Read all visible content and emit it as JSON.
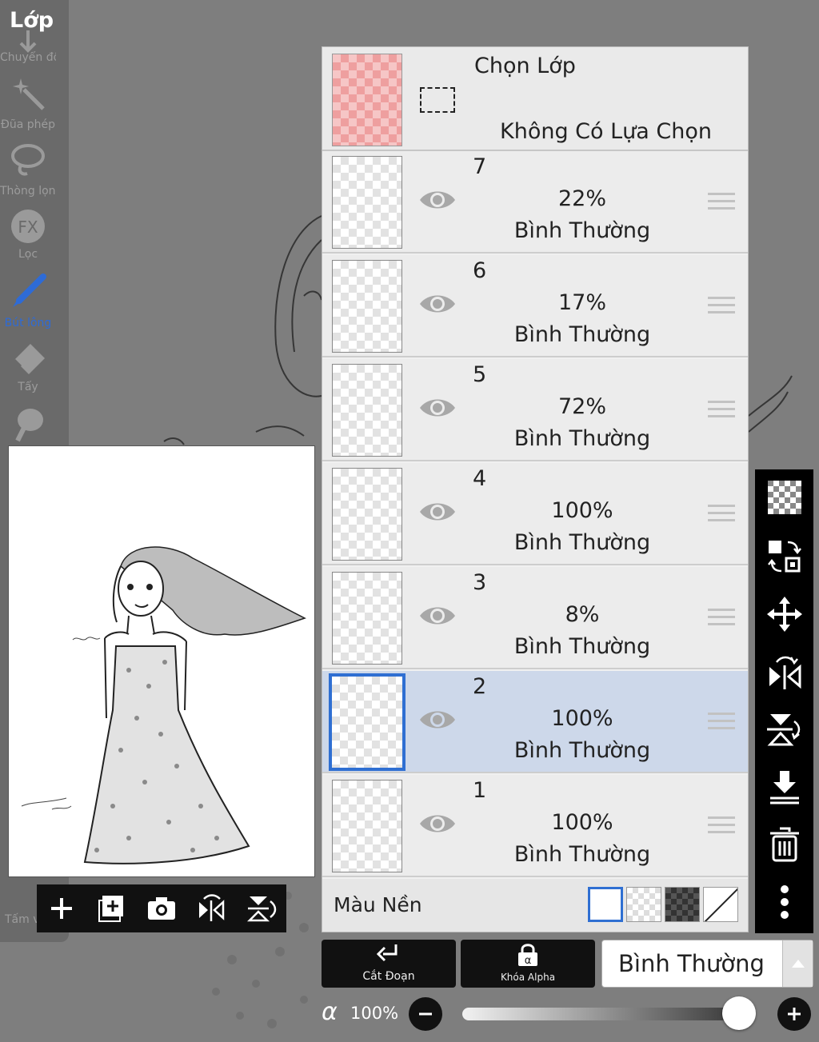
{
  "sidebar": {
    "title": "Lớp",
    "tools": [
      {
        "label": "Chuyển đổi",
        "icon": "transform-icon"
      },
      {
        "label": "Đũa phép",
        "icon": "magic-wand-icon"
      },
      {
        "label": "Thòng lọng",
        "icon": "lasso-icon"
      },
      {
        "label": "Lọc",
        "icon": "fx-filter-icon"
      },
      {
        "label": "Bút lông",
        "icon": "brush-icon",
        "active": true
      },
      {
        "label": "Tẩy",
        "icon": "eraser-icon"
      },
      {
        "label": "",
        "icon": "smudge-icon"
      }
    ],
    "bottom_label": "Tấm v"
  },
  "preview": {
    "toolbar": [
      {
        "name": "add-layer-button",
        "icon": "plus-icon"
      },
      {
        "name": "add-layer-copy-button",
        "icon": "add-square-icon"
      },
      {
        "name": "camera-button",
        "icon": "camera-icon"
      },
      {
        "name": "flip-horizontal-button",
        "icon": "flip-horizontal-icon"
      },
      {
        "name": "flip-vertical-button",
        "icon": "flip-vertical-icon"
      }
    ]
  },
  "layers_panel": {
    "selection": {
      "title": "Chọn Lớp",
      "status": "Không Có Lựa Chọn"
    },
    "layers": [
      {
        "number": "7",
        "opacity": "22%",
        "blend": "Bình Thường",
        "visible": true,
        "selected": false
      },
      {
        "number": "6",
        "opacity": "17%",
        "blend": "Bình Thường",
        "visible": true,
        "selected": false
      },
      {
        "number": "5",
        "opacity": "72%",
        "blend": "Bình Thường",
        "visible": true,
        "selected": false
      },
      {
        "number": "4",
        "opacity": "100%",
        "blend": "Bình Thường",
        "visible": true,
        "selected": false
      },
      {
        "number": "3",
        "opacity": "8%",
        "blend": "Bình Thường",
        "visible": true,
        "selected": false
      },
      {
        "number": "2",
        "opacity": "100%",
        "blend": "Bình Thường",
        "visible": true,
        "selected": true
      },
      {
        "number": "1",
        "opacity": "100%",
        "blend": "Bình Thường",
        "visible": true,
        "selected": false
      }
    ],
    "background": {
      "label": "Màu Nền",
      "options": [
        "white",
        "transparent",
        "dark-checker",
        "none"
      ],
      "selected": "white"
    }
  },
  "right_toolbar": [
    "checker-icon",
    "swap-layers-icon",
    "move-icon",
    "flip-horizontal-icon",
    "flip-vertical-icon",
    "merge-down-icon",
    "trash-icon",
    "more-icon"
  ],
  "bottom": {
    "clip_label": "Cắt Đoạn",
    "alpha_lock_label": "Khóa Alpha",
    "blend_mode": "Bình Thường",
    "alpha_symbol": "α",
    "alpha_value": "100%",
    "alpha_fraction": 1.0
  },
  "colors": {
    "selected_row": "#cdd8ea",
    "accent": "#2f6fd2",
    "active_tool": "#2e6bd6"
  }
}
